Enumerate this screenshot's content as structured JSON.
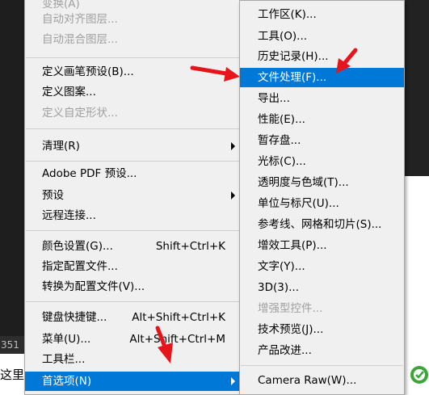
{
  "status_left": "351",
  "doc_fragment": "这里",
  "left_menu": {
    "items": [
      {
        "label": "变换(A)",
        "shortcut": "",
        "disabled": true
      },
      {
        "label": "自动对齐图层...",
        "shortcut": "",
        "disabled": true
      },
      {
        "label": "自动混合图层...",
        "shortcut": "",
        "disabled": true
      },
      {
        "label": "定义画笔预设(B)...",
        "shortcut": "",
        "disabled": false
      },
      {
        "label": "定义图案...",
        "shortcut": "",
        "disabled": false
      },
      {
        "label": "定义自定形状...",
        "shortcut": "",
        "disabled": true
      },
      {
        "label": "清理(R)",
        "shortcut": "",
        "disabled": false,
        "submenu": true
      },
      {
        "label": "Adobe PDF 预设...",
        "shortcut": "",
        "disabled": false
      },
      {
        "label": "预设",
        "shortcut": "",
        "disabled": false,
        "submenu": true
      },
      {
        "label": "远程连接...",
        "shortcut": "",
        "disabled": false
      },
      {
        "label": "颜色设置(G)...",
        "shortcut": "Shift+Ctrl+K",
        "disabled": false
      },
      {
        "label": "指定配置文件...",
        "shortcut": "",
        "disabled": false
      },
      {
        "label": "转换为配置文件(V)...",
        "shortcut": "",
        "disabled": false
      },
      {
        "label": "键盘快捷键...",
        "shortcut": "Alt+Shift+Ctrl+K",
        "disabled": false
      },
      {
        "label": "菜单(U)...",
        "shortcut": "Alt+Shift+Ctrl+M",
        "disabled": false
      },
      {
        "label": "工具栏...",
        "shortcut": "",
        "disabled": false
      },
      {
        "label": "首选项(N)",
        "shortcut": "",
        "disabled": false,
        "submenu": true,
        "highlighted": true
      }
    ]
  },
  "right_menu": {
    "items": [
      {
        "label": "工作区(K)..."
      },
      {
        "label": "工具(O)..."
      },
      {
        "label": "历史记录(H)..."
      },
      {
        "label": "文件处理(F)...",
        "highlighted": true
      },
      {
        "label": "导出..."
      },
      {
        "label": "性能(E)..."
      },
      {
        "label": "暂存盘..."
      },
      {
        "label": "光标(C)..."
      },
      {
        "label": "透明度与色域(T)..."
      },
      {
        "label": "单位与标尺(U)..."
      },
      {
        "label": "参考线、网格和切片(S)..."
      },
      {
        "label": "增效工具(P)..."
      },
      {
        "label": "文字(Y)..."
      },
      {
        "label": "3D(3)..."
      },
      {
        "label": "增强型控件...",
        "disabled": true
      },
      {
        "label": "技术预览(J)..."
      },
      {
        "label": "产品改进..."
      },
      {
        "label": "Camera Raw(W)..."
      }
    ]
  },
  "colors": {
    "highlight": "#0078d7",
    "annotation_arrow": "#e8141c",
    "menu_bg": "#f0f0f0"
  }
}
